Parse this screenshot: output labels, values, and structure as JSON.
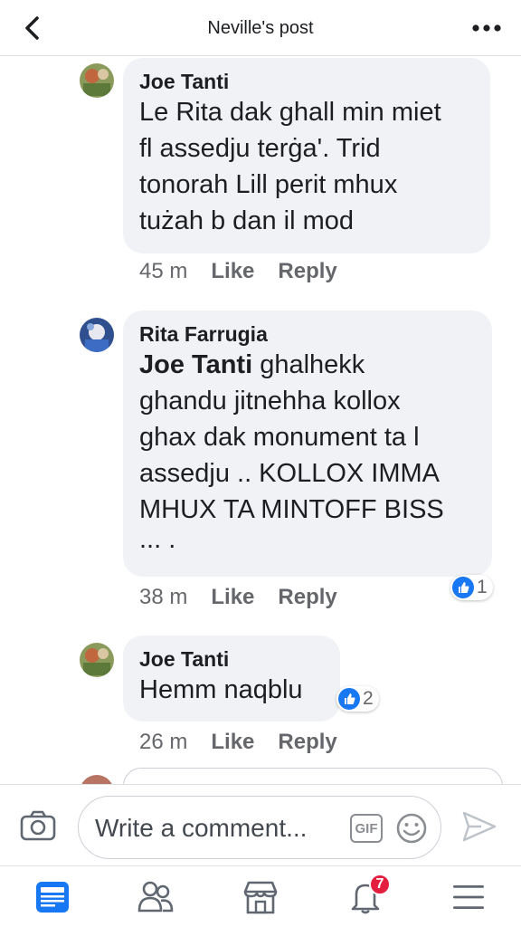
{
  "header": {
    "title": "Neville's post",
    "back_icon": "back-chevron-icon",
    "more_icon": "more-dots-icon"
  },
  "comments": [
    {
      "author": "Joe Tanti",
      "text_lines": [
        "Le Rita dak ghall min miet",
        "fl assedju terġa'. Trid",
        "tonorah Lill perit mhux",
        "tużah b dan il mod"
      ],
      "time": "45 m",
      "like_label": "Like",
      "reply_label": "Reply"
    },
    {
      "author": "Rita Farrugia",
      "mention": "Joe Tanti",
      "text_first_rest": " ghalhekk",
      "text_lines": [
        "ghandu jitnehha kollox",
        "ghax dak monument ta l",
        "assedju  .. KOLLOX IMMA",
        "MHUX TA MINTOFF BISS",
        "... ."
      ],
      "time": "38 m",
      "like_label": "Like",
      "reply_label": "Reply",
      "reaction_count": "1"
    },
    {
      "author": "Joe Tanti",
      "text_lines": [
        "Hemm naqblu"
      ],
      "time": "26 m",
      "like_label": "Like",
      "reply_label": "Reply",
      "reaction_count": "2"
    }
  ],
  "composer": {
    "placeholder": "Write a comment...",
    "gif_label": "GIF"
  },
  "nav": {
    "notifications_badge": "7",
    "accent": "#1877f2",
    "badge_color": "#e41e3f"
  }
}
